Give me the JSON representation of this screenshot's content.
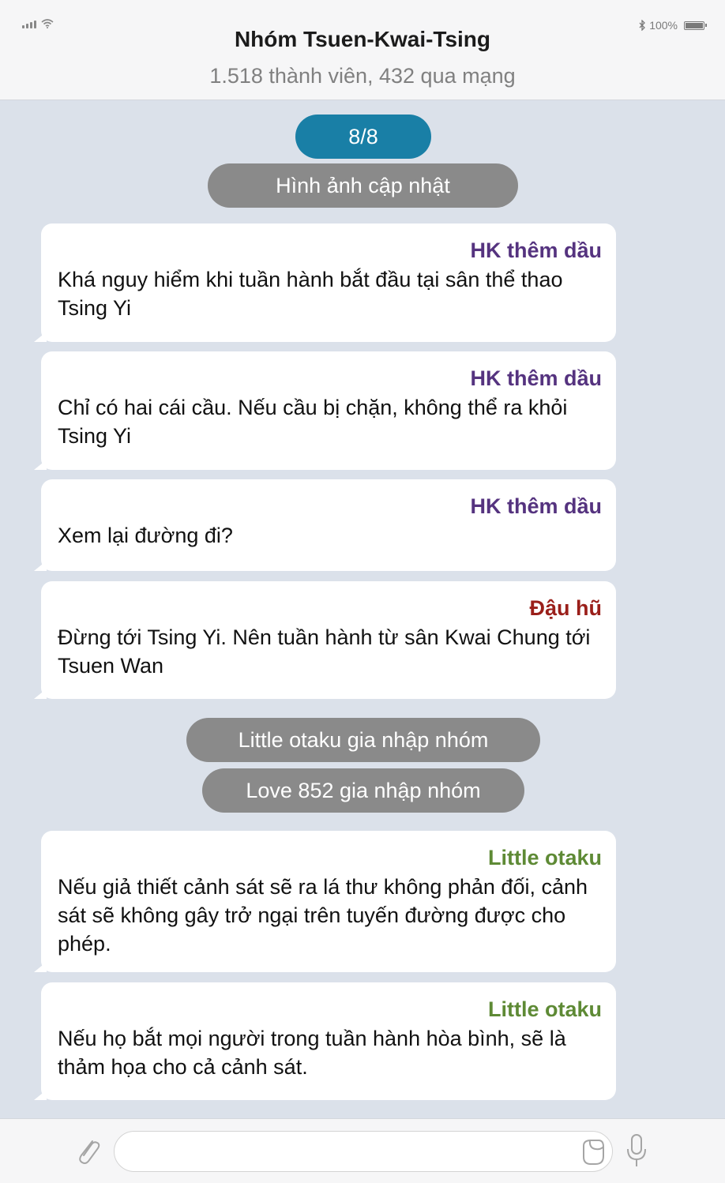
{
  "status": {
    "battery": "100%"
  },
  "header": {
    "title": "Nhóm Tsuen-Kwai-Tsing",
    "subtitle": "1.518 thành viên, 432 qua mạng"
  },
  "page_indicator": "8/8",
  "system_messages": {
    "photo_update": "Hình ảnh cập nhật",
    "join_1": "Little otaku gia nhập nhóm",
    "join_2": "Love 852 gia nhập nhóm"
  },
  "messages": [
    {
      "sender": "HK thêm dầu",
      "text": "Khá nguy hiểm khi tuần hành bắt đầu tại sân thể thao Tsing Yi",
      "color": "#55337f"
    },
    {
      "sender": "HK thêm dầu",
      "text": "Chỉ có hai cái cầu. Nếu cầu bị chặn, không thể ra khỏi Tsing Yi",
      "color": "#55337f"
    },
    {
      "sender": "HK thêm dầu",
      "text": "Xem lại đường đi?",
      "color": "#55337f"
    },
    {
      "sender": "Đậu hũ",
      "text": "Đừng tới Tsing Yi. Nên tuần hành từ sân Kwai Chung tới Tsuen Wan",
      "color": "#9a1f1a"
    },
    {
      "sender": "Little otaku",
      "text": "Nếu giả thiết cảnh sát sẽ ra lá thư không phản đối, cảnh sát sẽ không gây trở ngại trên tuyến đường được cho phép.",
      "color": "#5e8a35"
    },
    {
      "sender": "Little otaku",
      "text": "Nếu họ bắt mọi người trong tuần hành hòa bình, sẽ là thảm họa cho cả cảnh sát.",
      "color": "#5e8a35"
    }
  ],
  "composer": {
    "value": "",
    "icons": [
      "paperclip-icon",
      "sticker-icon",
      "microphone-icon"
    ]
  }
}
